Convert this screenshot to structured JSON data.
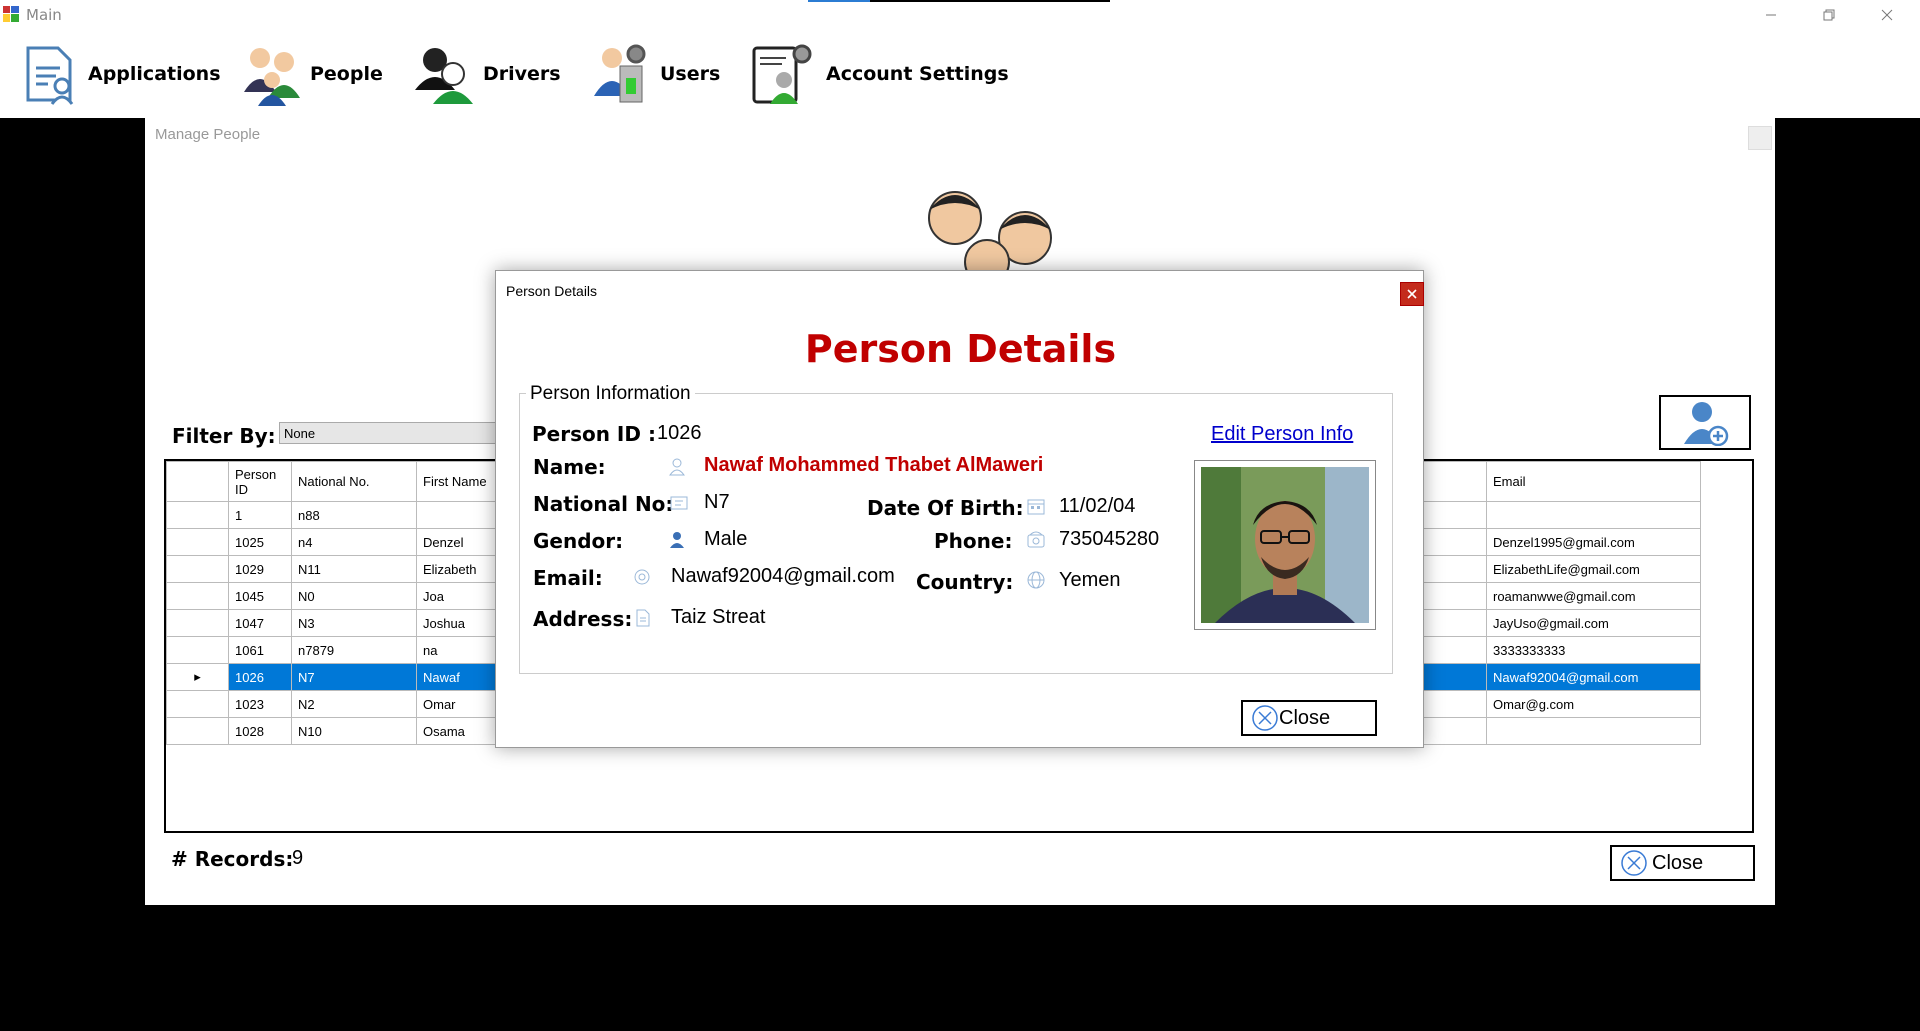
{
  "window": {
    "title": "Main"
  },
  "menu": {
    "applications": "Applications",
    "people": "People",
    "drivers": "Drivers",
    "users": "Users",
    "account_settings": "Account Settings"
  },
  "manage_people": {
    "title": "Manage People",
    "filter_label": "Filter By:",
    "filter_value": "None",
    "records_label": "# Records:",
    "records_value": "9",
    "close_label": "Close",
    "columns": {
      "person_id": "Person ID",
      "national_no": "National No.",
      "first_name": "First Name",
      "email": "Email"
    },
    "rows": [
      {
        "id": "1",
        "national_no": "n88",
        "first_name": "",
        "email": ""
      },
      {
        "id": "1025",
        "national_no": "n4",
        "first_name": "Denzel",
        "email": "Denzel1995@gmail.com"
      },
      {
        "id": "1029",
        "national_no": "N11",
        "first_name": "Elizabeth",
        "email": "ElizabethLife@gmail.com"
      },
      {
        "id": "1045",
        "national_no": "N0",
        "first_name": "Joa",
        "email": "roamanwwe@gmail.com"
      },
      {
        "id": "1047",
        "national_no": "N3",
        "first_name": "Joshua",
        "email": "JayUso@gmail.com"
      },
      {
        "id": "1061",
        "national_no": "n7879",
        "first_name": "na",
        "email": "3333333333"
      },
      {
        "id": "1026",
        "national_no": "N7",
        "first_name": "Nawaf",
        "email": "Nawaf92004@gmail.com",
        "selected": true
      },
      {
        "id": "1023",
        "national_no": "N2",
        "first_name": "Omar",
        "email": "Omar@g.com"
      },
      {
        "id": "1028",
        "national_no": "N10",
        "first_name": "Osama",
        "email": ""
      }
    ]
  },
  "dialog": {
    "window_title": "Person Details",
    "heading": "Person Details",
    "group_title": "Person Information",
    "edit_link": "Edit Person Info",
    "close_label": "Close",
    "labels": {
      "person_id": "Person ID :",
      "name": "Name:",
      "national_no": "National No:",
      "gender": "Gendor:",
      "email": "Email:",
      "address": "Address:",
      "dob": "Date Of Birth:",
      "phone": "Phone:",
      "country": "Country:"
    },
    "values": {
      "person_id": "1026",
      "name": "Nawaf Mohammed Thabet AlMaweri",
      "national_no": "N7",
      "gender": "Male",
      "email": "Nawaf92004@gmail.com",
      "address": "Taiz Streat",
      "dob": "11/02/04",
      "phone": "735045280",
      "country": "Yemen"
    }
  },
  "colors": {
    "heading_red": "#c00000",
    "selection_blue": "#0078d7",
    "link_blue": "#0000cc"
  },
  "icons": [
    "applications-icon",
    "people-icon",
    "drivers-icon",
    "users-icon",
    "account-settings-icon",
    "add-person-icon",
    "close-circle-icon"
  ]
}
